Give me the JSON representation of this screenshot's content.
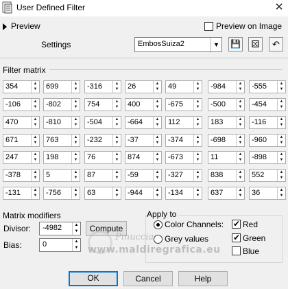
{
  "window": {
    "title": "User Defined Filter",
    "close_glyph": "✕"
  },
  "preview": {
    "label": "Preview",
    "preview_on_image_label": "Preview on Image",
    "preview_on_image_checked": false
  },
  "settings": {
    "label": "Settings",
    "preset_value": "EmbosSuiza2",
    "icons": [
      "save-icon",
      "randomize-icon",
      "reset-icon"
    ],
    "icon_glyphs": [
      "💾",
      "⚄",
      "↶"
    ]
  },
  "filter_matrix": {
    "label": "Filter matrix",
    "rows": [
      [
        "354",
        "699",
        "-316",
        "26",
        "49",
        "-984",
        "-555"
      ],
      [
        "-106",
        "-802",
        "754",
        "400",
        "-675",
        "-500",
        "-454"
      ],
      [
        "470",
        "-810",
        "-504",
        "-664",
        "112",
        "183",
        "-116"
      ],
      [
        "671",
        "763",
        "-232",
        "-37",
        "-374",
        "-698",
        "-960"
      ],
      [
        "247",
        "198",
        "76",
        "874",
        "-673",
        "11",
        "-898"
      ],
      [
        "-378",
        "5",
        "87",
        "-59",
        "-327",
        "838",
        "552"
      ],
      [
        "-131",
        "-756",
        "63",
        "-944",
        "-134",
        "637",
        "36"
      ]
    ]
  },
  "matrix_modifiers": {
    "label": "Matrix modifiers",
    "divisor_label": "Divisor:",
    "divisor_value": "-4982",
    "compute_label": "Compute",
    "bias_label": "Bias:",
    "bias_value": "0"
  },
  "apply_to": {
    "label": "Apply to",
    "color_channels_label": "Color Channels:",
    "color_channels_selected": true,
    "grey_values_label": "Grey values",
    "channels": [
      {
        "label": "Red",
        "checked": true
      },
      {
        "label": "Green",
        "checked": true
      },
      {
        "label": "Blue",
        "checked": false
      }
    ]
  },
  "buttons": {
    "ok": "OK",
    "cancel": "Cancel",
    "help": "Help"
  },
  "watermark": {
    "line1": "Pinuccia",
    "line2": "www.maldiregrafica.eu"
  }
}
